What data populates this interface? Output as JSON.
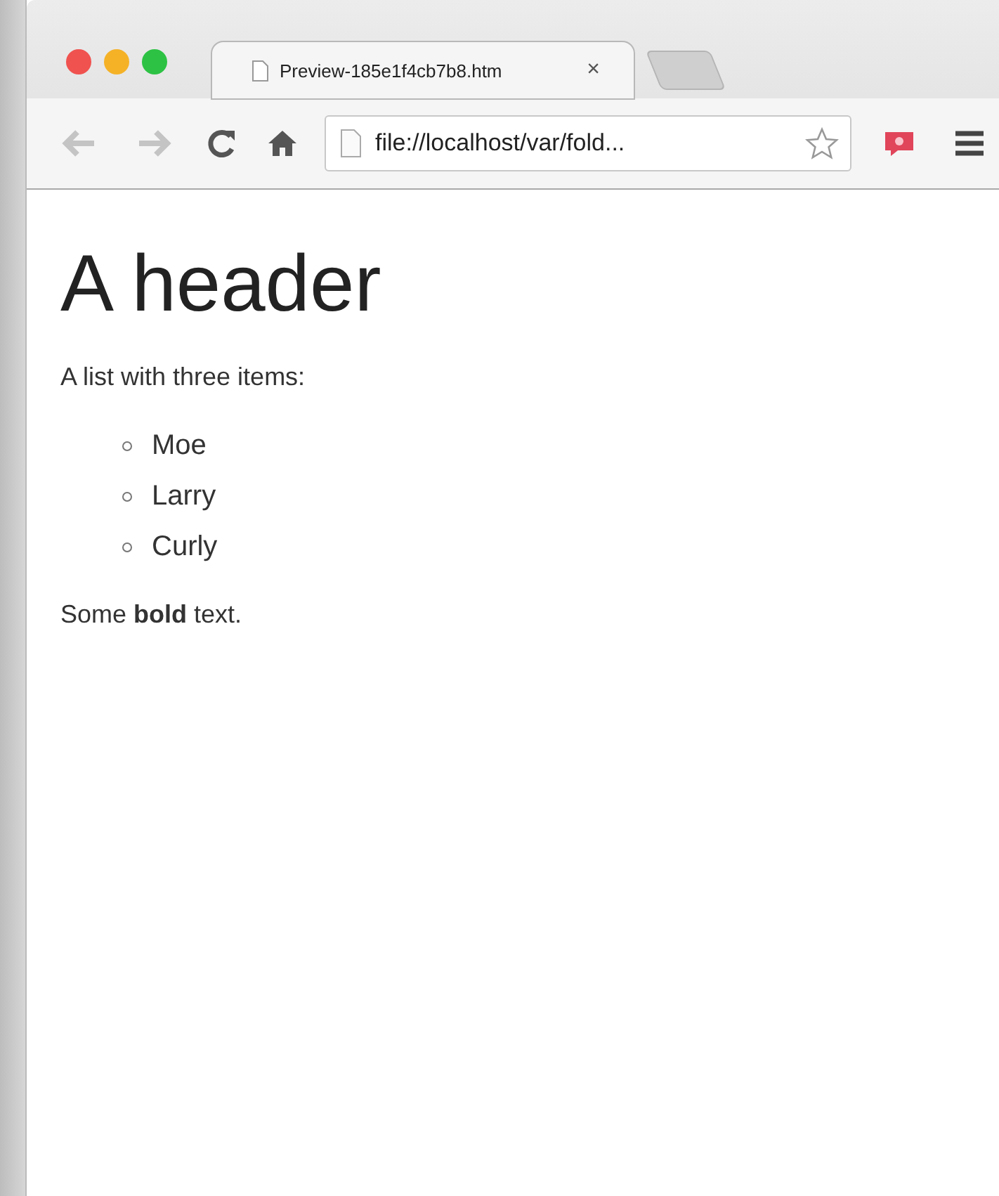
{
  "tabs": [
    {
      "label": "Preview-185e1f4cb7b8.htm",
      "close": "×",
      "selected": true
    }
  ],
  "address": {
    "value": "file://localhost/var/fold..."
  },
  "page": {
    "heading": "A header",
    "intro": "A list with three items:",
    "items": [
      "Moe",
      "Larry",
      "Curly"
    ],
    "closing": "Some **bold** text."
  }
}
